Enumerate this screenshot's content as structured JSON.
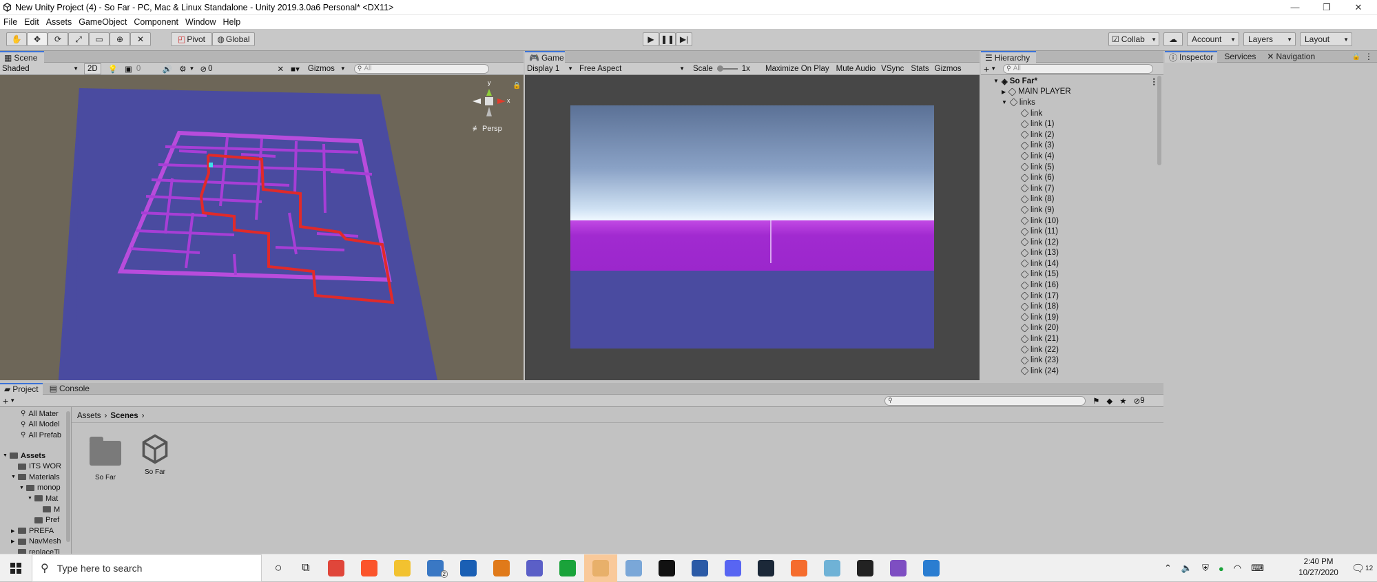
{
  "window": {
    "title": "New Unity Project (4) - So Far - PC, Mac & Linux Standalone - Unity 2019.3.0a6 Personal* <DX11>",
    "controls": [
      "—",
      "❐",
      "✕"
    ]
  },
  "menu": [
    "File",
    "Edit",
    "Assets",
    "GameObject",
    "Component",
    "Window",
    "Help"
  ],
  "toolbar": {
    "pivot": "Pivot",
    "global": "Global",
    "collab": "Collab",
    "account": "Account",
    "layers": "Layers",
    "layout": "Layout"
  },
  "scene": {
    "tab": "Scene",
    "shading": "Shaded",
    "mode2d": "2D",
    "fx_count": "0",
    "hidden_count": "0",
    "gizmos": "Gizmos",
    "search_placeholder": "All",
    "persp": "≢ Persp",
    "axis_y": "y",
    "axis_x": "x"
  },
  "game": {
    "tab": "Game",
    "display": "Display 1",
    "aspect": "Free Aspect",
    "scale_label": "Scale",
    "scale_value": "1x",
    "buttons": [
      "Maximize On Play",
      "Mute Audio",
      "VSync",
      "Stats",
      "Gizmos"
    ]
  },
  "hierarchy": {
    "tab": "Hierarchy",
    "search_placeholder": "All",
    "scene_name": "So Far*",
    "items": [
      {
        "label": "MAIN PLAYER",
        "depth": 1
      },
      {
        "label": "links",
        "depth": 1
      },
      {
        "label": "link",
        "depth": 2
      },
      {
        "label": "link (1)",
        "depth": 2
      },
      {
        "label": "link (2)",
        "depth": 2
      },
      {
        "label": "link (3)",
        "depth": 2
      },
      {
        "label": "link (4)",
        "depth": 2
      },
      {
        "label": "link (5)",
        "depth": 2
      },
      {
        "label": "link (6)",
        "depth": 2
      },
      {
        "label": "link (7)",
        "depth": 2
      },
      {
        "label": "link (8)",
        "depth": 2
      },
      {
        "label": "link (9)",
        "depth": 2
      },
      {
        "label": "link (10)",
        "depth": 2
      },
      {
        "label": "link (11)",
        "depth": 2
      },
      {
        "label": "link (12)",
        "depth": 2
      },
      {
        "label": "link (13)",
        "depth": 2
      },
      {
        "label": "link (14)",
        "depth": 2
      },
      {
        "label": "link (15)",
        "depth": 2
      },
      {
        "label": "link (16)",
        "depth": 2
      },
      {
        "label": "link (17)",
        "depth": 2
      },
      {
        "label": "link (18)",
        "depth": 2
      },
      {
        "label": "link (19)",
        "depth": 2
      },
      {
        "label": "link (20)",
        "depth": 2
      },
      {
        "label": "link (21)",
        "depth": 2
      },
      {
        "label": "link (22)",
        "depth": 2
      },
      {
        "label": "link (23)",
        "depth": 2
      },
      {
        "label": "link (24)",
        "depth": 2
      }
    ]
  },
  "inspector": {
    "tabs": [
      "Inspector",
      "Services",
      "Navigation"
    ]
  },
  "project": {
    "tabs": [
      "Project",
      "Console"
    ],
    "favorites": [
      "All Mater",
      "All Model",
      "All Prefab"
    ],
    "tree": [
      {
        "label": "Assets",
        "depth": 0,
        "bold": true
      },
      {
        "label": "ITS WOR",
        "depth": 1
      },
      {
        "label": "Materials",
        "depth": 1
      },
      {
        "label": "monop",
        "depth": 2
      },
      {
        "label": "Mat",
        "depth": 3
      },
      {
        "label": "M",
        "depth": 4
      },
      {
        "label": "Pref",
        "depth": 3
      },
      {
        "label": "PREFA",
        "depth": 1
      },
      {
        "label": "NavMesh",
        "depth": 1
      },
      {
        "label": "replaceTi",
        "depth": 1
      }
    ],
    "breadcrumb": [
      "Assets",
      "Scenes"
    ],
    "assets": [
      {
        "label": "So Far",
        "kind": "folder"
      },
      {
        "label": "So Far",
        "kind": "scene"
      }
    ],
    "hidden_count": "9"
  },
  "taskbar": {
    "search_placeholder": "Type here to search",
    "time": "2:40 PM",
    "date": "10/27/2020",
    "notification_count": "12",
    "mail_badge": "2",
    "apps": [
      {
        "icon": "chrome-icon",
        "color": "#e0463a"
      },
      {
        "icon": "brave-icon",
        "color": "#fb542b"
      },
      {
        "icon": "file-explorer-icon",
        "color": "#f2c230"
      },
      {
        "icon": "mail-icon",
        "color": "#3a78c4"
      },
      {
        "icon": "outlook-icon",
        "color": "#1a5fb4"
      },
      {
        "icon": "search-app-icon",
        "color": "#e07a1a"
      },
      {
        "icon": "teams-icon",
        "color": "#5b5fc7"
      },
      {
        "icon": "razer-icon",
        "color": "#1aa33a"
      },
      {
        "icon": "files-icon",
        "color": "#e8b06a"
      },
      {
        "icon": "paint-icon",
        "color": "#7aa7d8"
      },
      {
        "icon": "xbox-icon",
        "color": "#111111"
      },
      {
        "icon": "word-icon",
        "color": "#2b5aa6"
      },
      {
        "icon": "discord-icon",
        "color": "#5865f2"
      },
      {
        "icon": "steam-icon",
        "color": "#1b2838"
      },
      {
        "icon": "origin-icon",
        "color": "#f56c2d"
      },
      {
        "icon": "app-icon",
        "color": "#6fb2d6"
      },
      {
        "icon": "unity-icon",
        "color": "#222222"
      },
      {
        "icon": "visual-studio-icon",
        "color": "#7e4ec2"
      },
      {
        "icon": "photos-icon",
        "color": "#2a7dd1"
      }
    ]
  }
}
